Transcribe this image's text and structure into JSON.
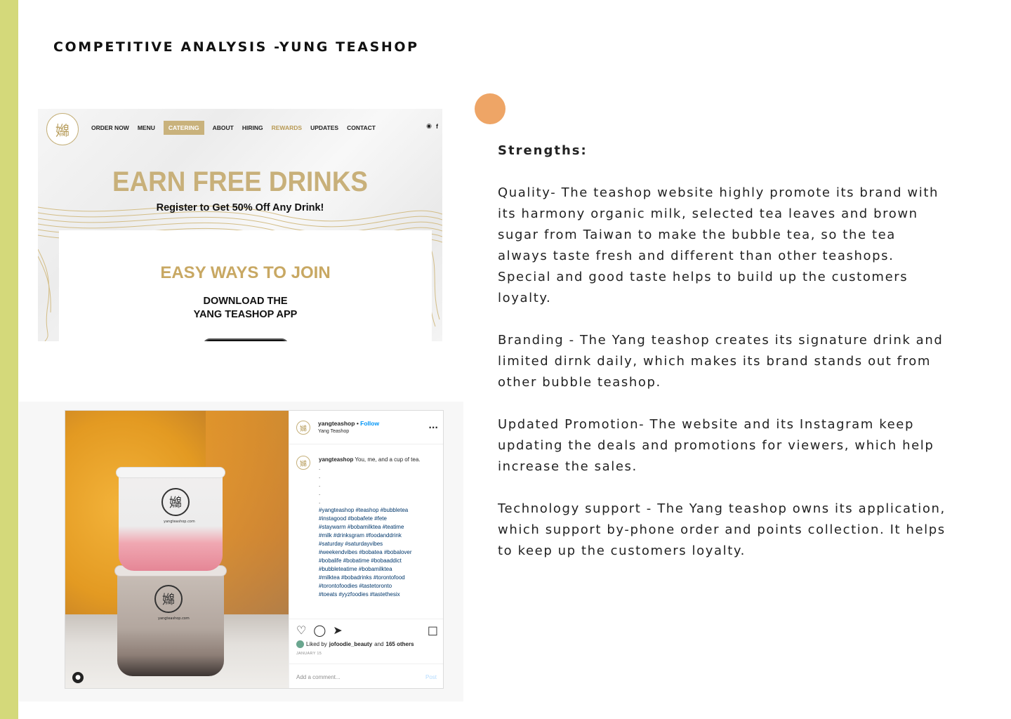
{
  "page": {
    "title": "COMPETITIVE ANALYSIS -YUNG TEASHOP"
  },
  "colors": {
    "left_stripe": "#d4d97a",
    "accent_dot": "#eea566",
    "gold": "#c8b07a"
  },
  "analysis": {
    "heading": "Strengths:",
    "paragraphs": [
      "Quality- The teashop website highly promote its brand with its harmony organic milk, selected tea leaves and brown sugar from Taiwan to make the bubble tea, so the tea always taste fresh and different than other teashops. Special and good taste helps to build up the customers loyalty.",
      "Branding - The Yang teashop creates its signature drink and limited dirnk daily, which makes its brand stands out from other bubble teashop.",
      "Updated Promotion- The website and its Instagram keep updating the deals and promotions for viewers, which help increase the sales.",
      "Technology support - The Yang teashop owns its application, which support by-phone order and points collection. It helps to keep up the customers loyalty."
    ]
  },
  "website": {
    "logo_icon": "yang-teashop-logo",
    "nav": [
      "ORDER NOW",
      "MENU",
      "CATERING",
      "ABOUT",
      "HIRING",
      "REWARDS",
      "UPDATES",
      "CONTACT"
    ],
    "social_icons": [
      "instagram-icon",
      "facebook-icon"
    ],
    "hero_title": "EARN FREE DRINKS",
    "hero_subtitle": "Register to Get 50% Off Any Drink!",
    "join_title": "EASY WAYS TO JOIN",
    "join_step_line1": "DOWNLOAD THE",
    "join_step_line2": "YANG TEASHOP APP"
  },
  "instagram": {
    "cup_url": "yangteashop.com",
    "username": "yangteashop",
    "follow_separator": "•",
    "follow": "Follow",
    "subtitle": "Yang Teashop",
    "more": "...",
    "caption_user": "yangteashop",
    "caption_text": "You, me, and a cup of tea.",
    "dots": [
      ".",
      ".",
      ".",
      ".",
      "."
    ],
    "hashtag_lines": [
      "#yangteashop #teashop #bubbletea",
      "#instagood #bobafete #fete",
      "#staywarm #bobamilktea #teatime",
      "#milk #drinksgram #foodanddrink",
      "#saturday #saturdayvibes",
      "#weekendvibes #bobatea #bobalover",
      "#bobalife #bobatime #bobaaddict",
      "#bubbleteatime #bobamilktea",
      "#milktea #bobadrinks #torontofood",
      "#torontofoodies #tastetoronto",
      "#toeats #yyzfoodies #tastethesix"
    ],
    "liked_prefix": "Liked by",
    "liked_user": "jofoodie_beauty",
    "liked_and": "and",
    "liked_others": "165 others",
    "date": "JANUARY 15",
    "comment_placeholder": "Add a comment...",
    "post": "Post",
    "action_icons": [
      "heart-icon",
      "comment-icon",
      "share-icon",
      "bookmark-icon"
    ]
  }
}
